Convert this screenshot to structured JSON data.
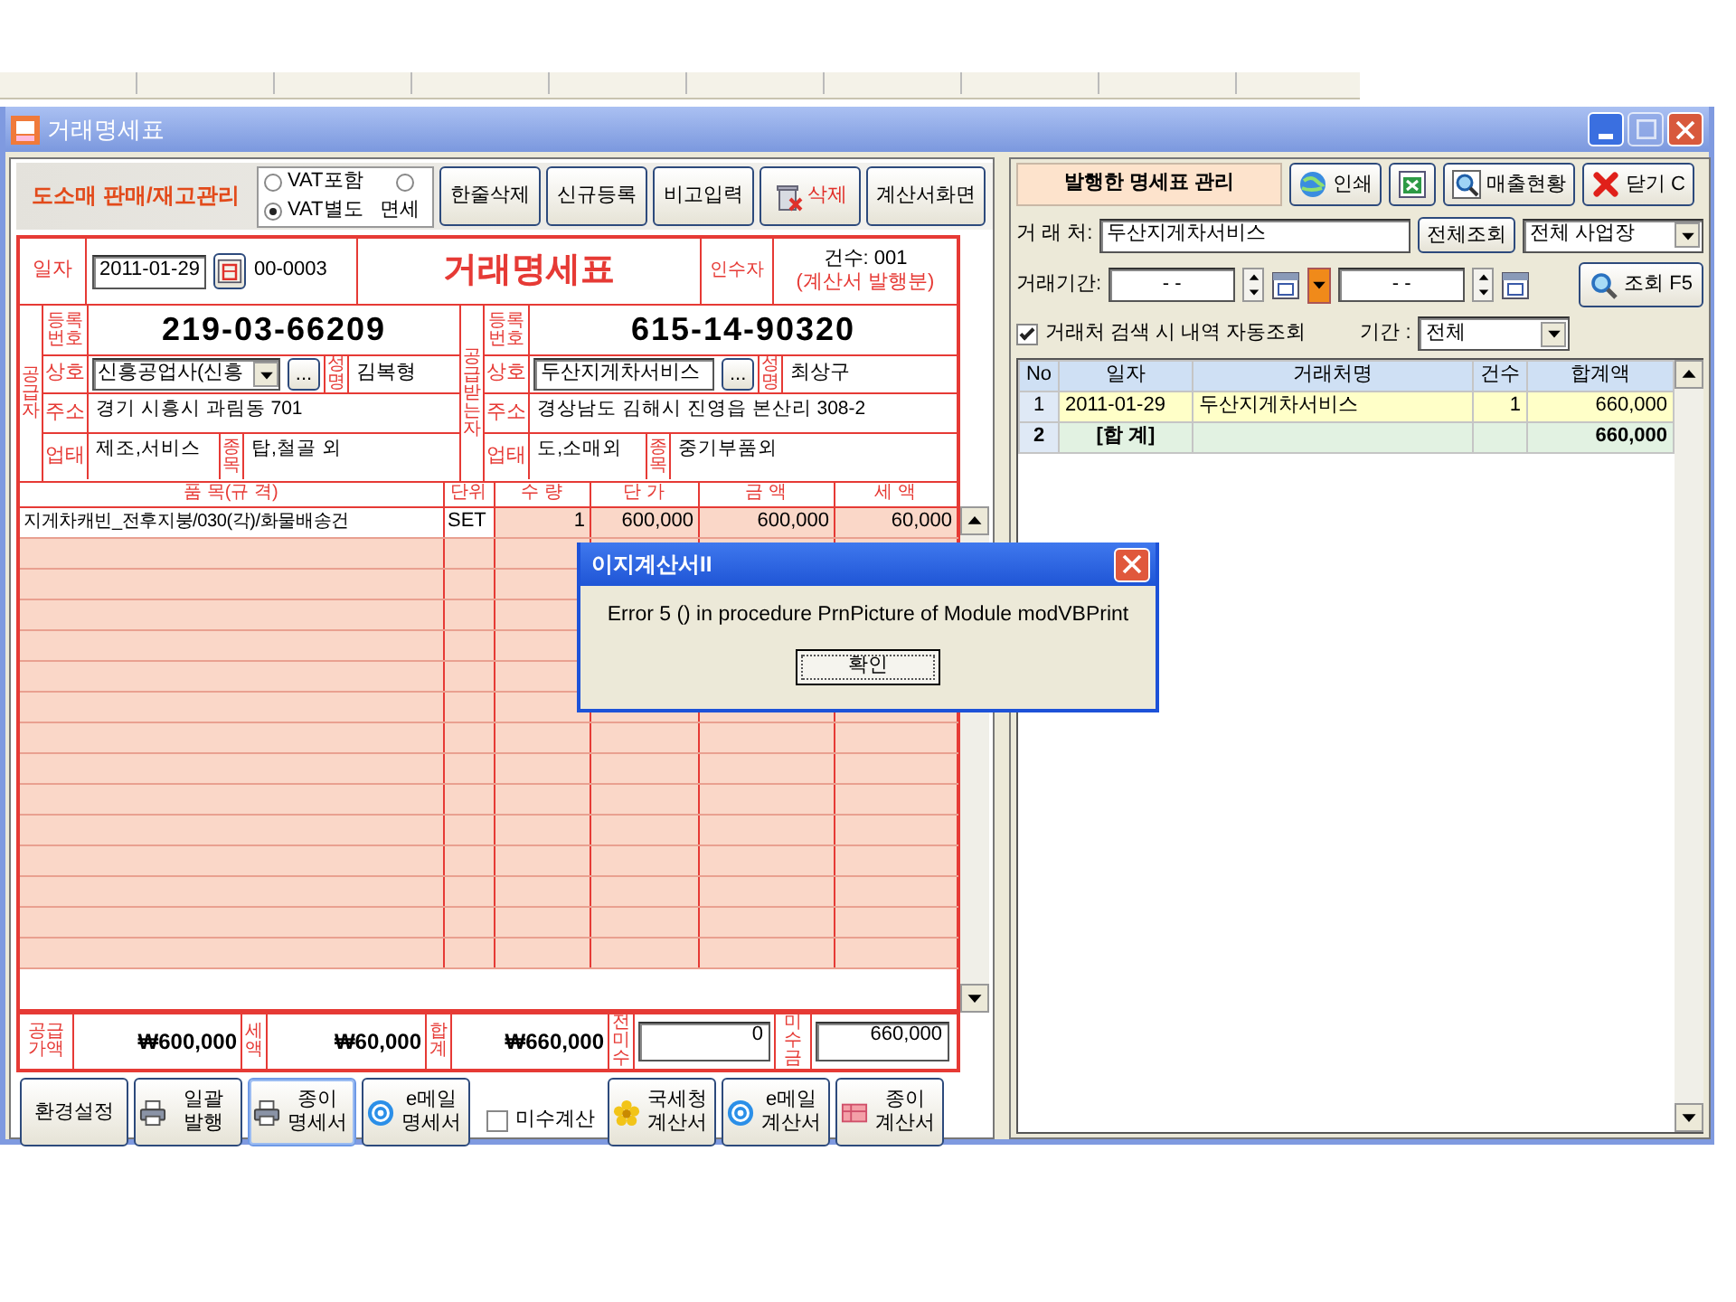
{
  "window": {
    "title": "거래명세표"
  },
  "toolbar": {
    "heading": "도소매 판매/재고관리",
    "vat_options": [
      {
        "label": "VAT포함",
        "selected": false
      },
      {
        "label": "VAT별도",
        "selected": true
      },
      {
        "label": "면세",
        "selected": false
      }
    ],
    "buttons": [
      {
        "label": "한줄삭제",
        "kind": "plain"
      },
      {
        "label": "신규등록",
        "kind": "plain"
      },
      {
        "label": "비고입력",
        "kind": "plain"
      },
      {
        "label": "삭제",
        "kind": "delete"
      },
      {
        "label": "계산서화면",
        "kind": "plain"
      }
    ]
  },
  "invoice": {
    "date_label": "일자",
    "date": "2011-01-29",
    "number": "00-0003",
    "title": "거래명세표",
    "receiver_label": "인수자",
    "count": "건수: 001",
    "note": "(계산서 발행분)",
    "supplier": {
      "side_label": "공급자",
      "reg_label": "등록번호",
      "reg_no": "219-03-66209",
      "company_label": "상호",
      "company": {
        "value": "신흥공업사(신흥",
        "kind": "combo"
      },
      "browse_button": "...",
      "owner_label": "성명",
      "owner": "김복형",
      "address_label": "주소",
      "address": "경기 시흥시 과림동 701",
      "business_label": "업태",
      "business": "제조,서비스",
      "item_label": "종목",
      "item": "탑,철골 외"
    },
    "buyer": {
      "side_label": "공급받는자",
      "reg_label": "등록번호",
      "reg_no": "615-14-90320",
      "company_label": "상호",
      "company": {
        "value": "두산지게차서비스",
        "kind": "field"
      },
      "browse_button": "...",
      "owner_label": "성명",
      "owner": "최상구",
      "address_label": "주소",
      "address": "경상남도 김해시 진영읍 본산리 308-2",
      "business_label": "업태",
      "business": "도,소매외",
      "item_label": "종목",
      "item": "중기부품외"
    }
  },
  "items": {
    "columns": [
      "품 목(규 격)",
      "단위",
      "수 량",
      "단 가",
      "금 액",
      "세 액"
    ],
    "rows": [
      [
        "지게차캐빈_전후지붕/030(각)/화물배송건",
        "SET",
        "1",
        "600,000",
        "600,000",
        "60,000"
      ]
    ]
  },
  "totals": [
    {
      "label": "공급가액",
      "value": "₩600,000",
      "kind": "text"
    },
    {
      "label": "세액",
      "value": "₩60,000",
      "kind": "text"
    },
    {
      "label": "합계",
      "value": "₩660,000",
      "kind": "text"
    },
    {
      "label": "전미수",
      "value": "0",
      "kind": "field"
    },
    {
      "label": "미수금",
      "value": "660,000",
      "kind": "field"
    }
  ],
  "bottom_bar": [
    {
      "kind": "plain",
      "label": "환경설정",
      "focused": false
    },
    {
      "kind": "print",
      "label": "일괄 발행",
      "focused": false
    },
    {
      "kind": "print",
      "label": "종이 명세서",
      "focused": true
    },
    {
      "kind": "email",
      "label": "e메일 명세서",
      "focused": false
    },
    {
      "kind": "checkbox",
      "label": "미수계산",
      "checked": false
    },
    {
      "kind": "tax",
      "label": "국세청 계산서",
      "focused": false
    },
    {
      "kind": "email",
      "label": "e메일 계산서",
      "focused": false
    },
    {
      "kind": "paper",
      "label": "종이 계산서",
      "focused": false
    }
  ],
  "issued": {
    "heading": "발행한 명세표 관리",
    "buttons": [
      {
        "label": "인쇄",
        "kind": "print"
      },
      {
        "kind": "export"
      },
      {
        "label": "매출현황",
        "kind": "report"
      },
      {
        "label": "닫기 C",
        "kind": "close"
      }
    ],
    "client_label": "거 래 처:",
    "client": "두산지게차서비스",
    "all_button": "전체조회",
    "site_select": "전체 사업장",
    "period_label": "거래기간:",
    "from": "-   -",
    "to": "-   -",
    "search_button": "조회 F5",
    "auto_check": {
      "label": "거래처 검색 시 내역 자동조회",
      "checked": true
    },
    "range_label": "기간 :",
    "range": "전체",
    "table": {
      "columns": [
        "No",
        "일자",
        "거래처명",
        "건수",
        "합계액"
      ],
      "rows": [
        {
          "kind": "entry",
          "selected": true,
          "no": "1",
          "date": "2011-01-29",
          "client": "두산지게차서비스",
          "count": "1",
          "amount": "660,000"
        },
        {
          "kind": "total",
          "selected": false,
          "no": "2",
          "date": "[합 계]",
          "amount": "660,000"
        }
      ]
    }
  },
  "dialog": {
    "title": "이지계산서II",
    "message": "Error 5 () in procedure PrnPicture of Module modVBPrint",
    "button": "확인"
  }
}
